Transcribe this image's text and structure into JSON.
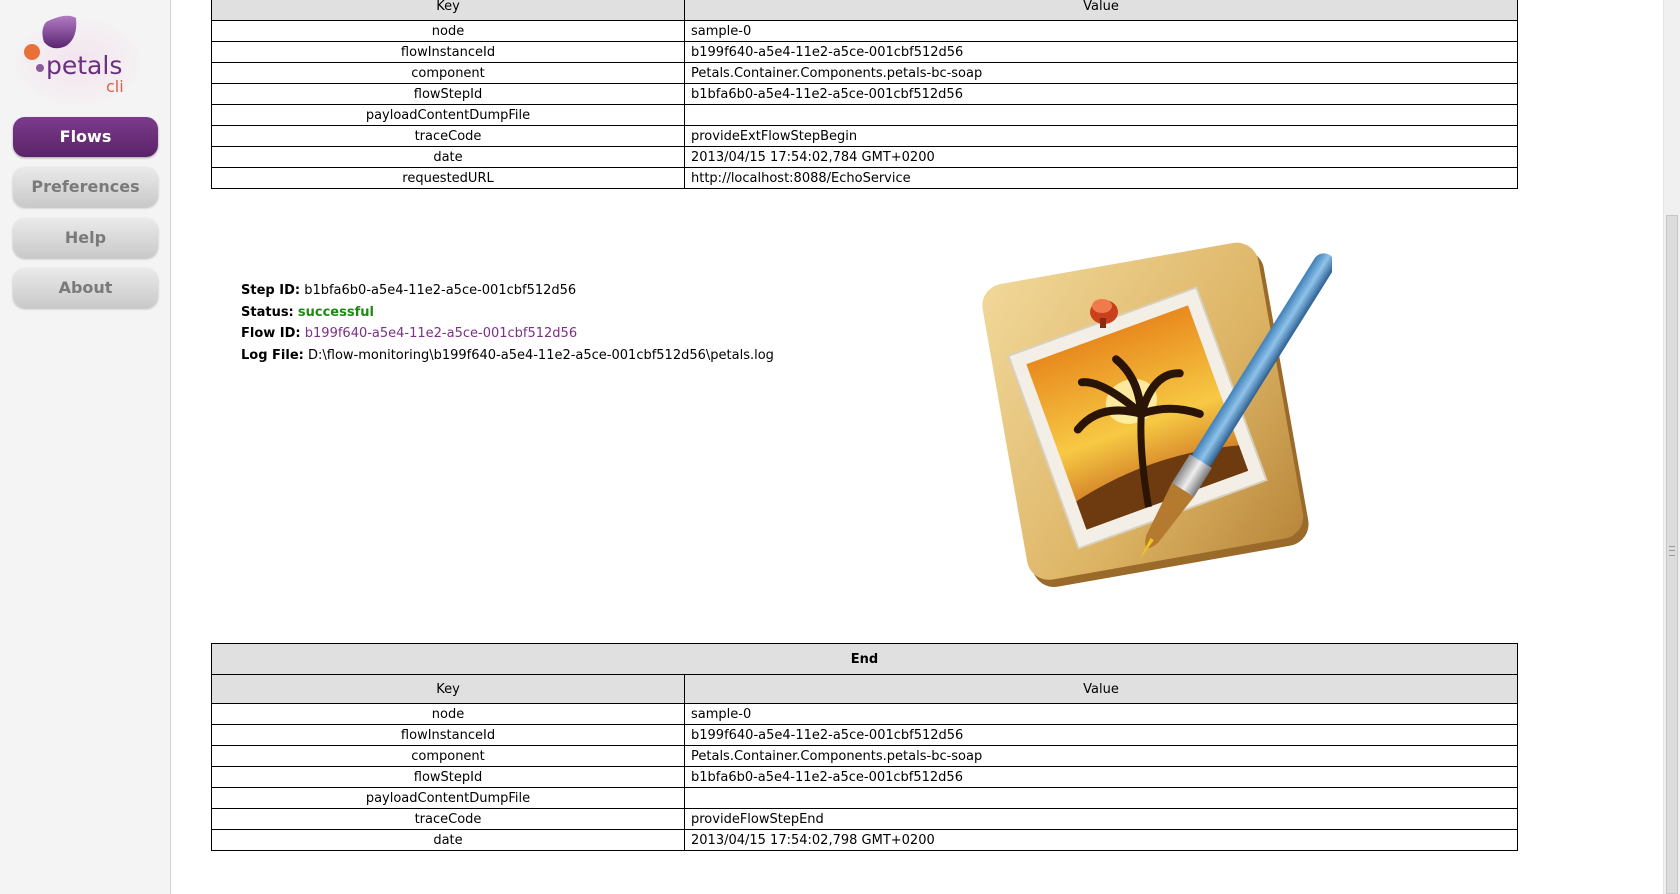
{
  "logo": {
    "text": "petals",
    "subtext": "cli"
  },
  "nav": [
    {
      "label": "Flows",
      "active": true
    },
    {
      "label": "Preferences",
      "active": false
    },
    {
      "label": "Help",
      "active": false
    },
    {
      "label": "About",
      "active": false
    }
  ],
  "top_table": {
    "headers": [
      "Key",
      "Value"
    ],
    "rows": [
      [
        "node",
        "sample-0"
      ],
      [
        "flowInstanceId",
        "b199f640-a5e4-11e2-a5ce-001cbf512d56"
      ],
      [
        "component",
        "Petals.Container.Components.petals-bc-soap"
      ],
      [
        "flowStepId",
        "b1bfa6b0-a5e4-11e2-a5ce-001cbf512d56"
      ],
      [
        "payloadContentDumpFile",
        ""
      ],
      [
        "traceCode",
        "provideExtFlowStepBegin"
      ],
      [
        "date",
        "2013/04/15 17:54:02,784 GMT+0200"
      ],
      [
        "requestedURL",
        "http://localhost:8088/EchoService"
      ]
    ]
  },
  "step_info": {
    "step_id_label": "Step ID:",
    "step_id": "b1bfa6b0-a5e4-11e2-a5ce-001cbf512d56",
    "status_label": "Status:",
    "status": "successful",
    "flow_id_label": "Flow ID:",
    "flow_id": "b199f640-a5e4-11e2-a5ce-001cbf512d56",
    "log_file_label": "Log File:",
    "log_file": "D:\\flow-monitoring\\b199f640-a5e4-11e2-a5ce-001cbf512d56\\petals.log"
  },
  "end_table": {
    "title": "End",
    "headers": [
      "Key",
      "Value"
    ],
    "rows": [
      [
        "node",
        "sample-0"
      ],
      [
        "flowInstanceId",
        "b199f640-a5e4-11e2-a5ce-001cbf512d56"
      ],
      [
        "component",
        "Petals.Container.Components.petals-bc-soap"
      ],
      [
        "flowStepId",
        "b1bfa6b0-a5e4-11e2-a5ce-001cbf512d56"
      ],
      [
        "payloadContentDumpFile",
        ""
      ],
      [
        "traceCode",
        "provideFlowStepEnd"
      ],
      [
        "date",
        "2013/04/15 17:54:02,798 GMT+0200"
      ]
    ]
  },
  "colors": {
    "accent": "#5a2368",
    "status_ok": "#1e8a14",
    "link": "#7b2f86",
    "header_bg": "#e0e0e0"
  },
  "icons": {
    "logo": "petals-logo",
    "preview": "pixelmator-image-icon"
  }
}
